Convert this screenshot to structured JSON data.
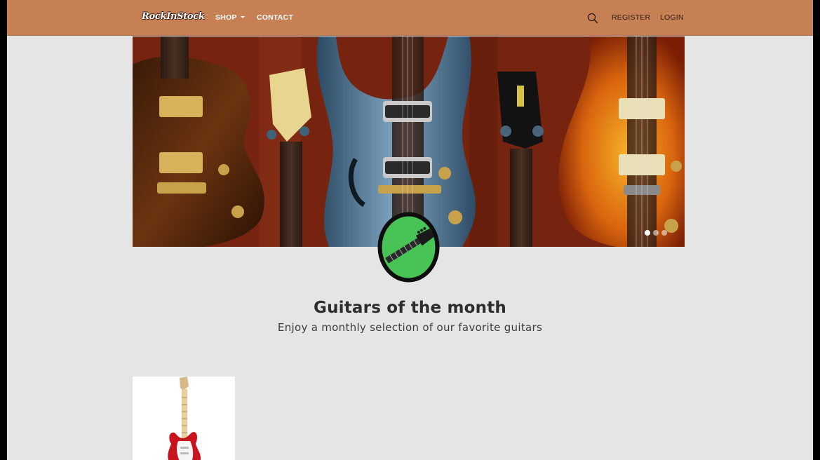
{
  "navbar": {
    "logo": "RockInStock",
    "shop_label": "SHOP",
    "contact_label": "CONTACT",
    "register_label": "REGISTER",
    "login_label": "LOGIN"
  },
  "carousel": {
    "slide_count": 3,
    "active_index": 0
  },
  "section": {
    "title": "Guitars of the month",
    "subtitle": "Enjoy a monthly selection of our favorite guitars"
  },
  "colors": {
    "navbar_bg": "#c77f54",
    "badge_green": "#47c455",
    "page_bg": "#e5e5e5"
  },
  "icons": {
    "search": "search-icon",
    "badge": "guitar-icon"
  }
}
